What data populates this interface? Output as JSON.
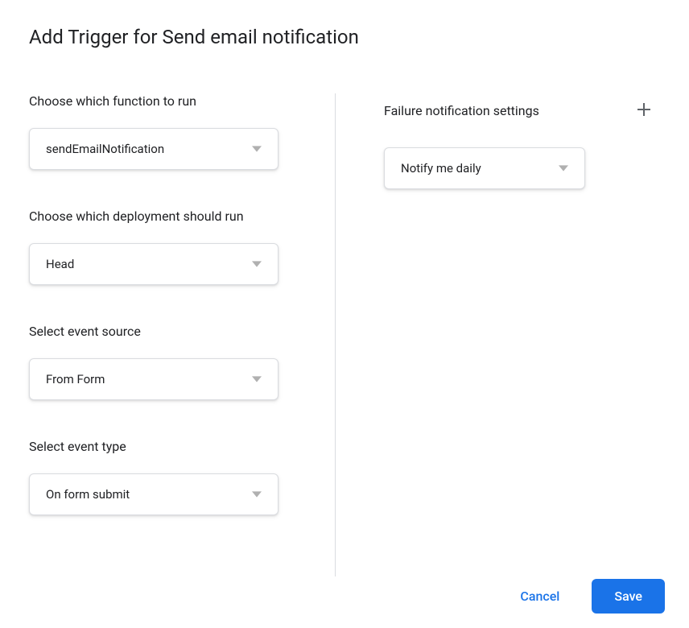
{
  "dialog": {
    "title": "Add Trigger for Send email notification"
  },
  "left": {
    "function": {
      "label": "Choose which function to run",
      "value": "sendEmailNotification"
    },
    "deployment": {
      "label": "Choose which deployment should run",
      "value": "Head"
    },
    "eventSource": {
      "label": "Select event source",
      "value": "From Form"
    },
    "eventType": {
      "label": "Select event type",
      "value": "On form submit"
    }
  },
  "right": {
    "failureNotification": {
      "label": "Failure notification settings",
      "value": "Notify me daily"
    }
  },
  "buttons": {
    "cancel": "Cancel",
    "save": "Save"
  }
}
